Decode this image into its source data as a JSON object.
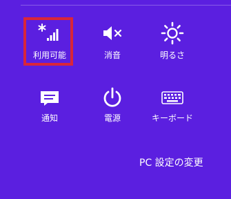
{
  "quick_settings": {
    "network": {
      "label": "利用可能",
      "icon": "wifi-available-icon"
    },
    "volume": {
      "label": "消音",
      "icon": "speaker-muted-icon"
    },
    "brightness": {
      "label": "明るさ",
      "icon": "brightness-icon"
    },
    "notifications": {
      "label": "通知",
      "icon": "notifications-icon"
    },
    "power": {
      "label": "電源",
      "icon": "power-icon"
    },
    "keyboard": {
      "label": "キーボード",
      "icon": "keyboard-icon"
    }
  },
  "footer": {
    "pc_settings_label": "PC 設定の変更"
  },
  "colors": {
    "background": "#5b1fe0",
    "highlight": "#d9263a",
    "foreground": "#ffffff"
  }
}
